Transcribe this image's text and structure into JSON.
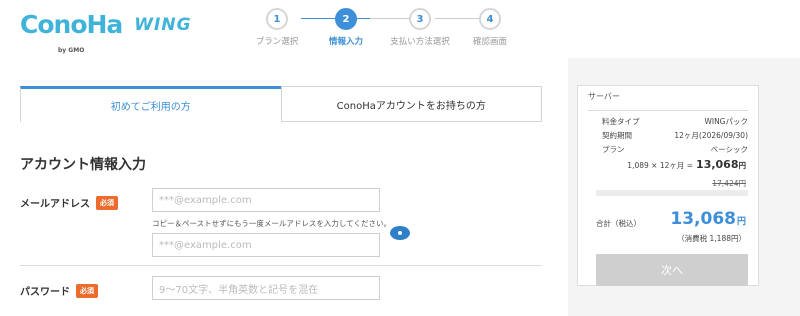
{
  "header": {
    "logo_text": "ConoHa",
    "logo_by": "by GMO",
    "logo_product": "WING"
  },
  "steps": [
    {
      "number": "1",
      "label": "プラン選択",
      "active": false
    },
    {
      "number": "2",
      "label": "情報入力",
      "active": true
    },
    {
      "number": "3",
      "label": "支払い方法選択",
      "active": false
    },
    {
      "number": "4",
      "label": "確認画面",
      "active": false
    }
  ],
  "tabs": {
    "first_time": "初めてご利用の方",
    "have_account": "ConoHaアカウントをお持ちの方"
  },
  "form": {
    "section_title": "アカウント情報入力",
    "email_label": "メールアドレス",
    "required_badge": "必須",
    "email_placeholder": "***@example.com",
    "email_hint": "コピー＆ペーストせずにもう一度メールアドレスを入力してください。",
    "email_confirm_placeholder": "***@example.com",
    "password_label": "パスワード",
    "password_placeholder": "9～70文字、半角英数と記号を混在"
  },
  "summary": {
    "heading": "サーバー",
    "rows": [
      {
        "label": "料金タイプ",
        "value": "WINGパック"
      },
      {
        "label": "契約期間",
        "value": "12ヶ月(2026/09/30)"
      },
      {
        "label": "プラン",
        "value": "ベーシック"
      }
    ],
    "calc_text": "1,089 × 12ヶ月 =",
    "calc_total": "13,068",
    "yen": "円",
    "strike_price": "17,424円",
    "total_label": "合計（税込）",
    "total_price": "13,068",
    "tax_text": "（消費税 1,188円）",
    "next_button": "次へ"
  },
  "colors": {
    "accent": "#3d8fd8",
    "logo": "#3fb3d8",
    "required": "#ec6b2d"
  }
}
